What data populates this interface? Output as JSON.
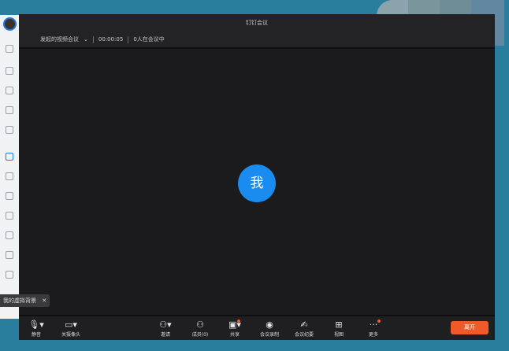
{
  "window": {
    "title": "钉钉会议"
  },
  "meeting": {
    "name": "发起的视频会议",
    "timer": "00:00:05",
    "participants_status": "0人在会议中"
  },
  "avatar": {
    "label": "我",
    "color": "#1a8cf0"
  },
  "tooltip": {
    "text": "我的虚拟背景"
  },
  "toolbar": {
    "mute": "静音",
    "camera": "关摄像头",
    "invite": "邀请",
    "members": "成员(0)",
    "share": "共享",
    "record": "会议录制",
    "minutes": "会议纪要",
    "view": "视图",
    "more": "更多",
    "leave": "离开"
  },
  "colors": {
    "accent": "#1a8cf0",
    "leave": "#f05a28",
    "background": "#2a7e9d"
  }
}
